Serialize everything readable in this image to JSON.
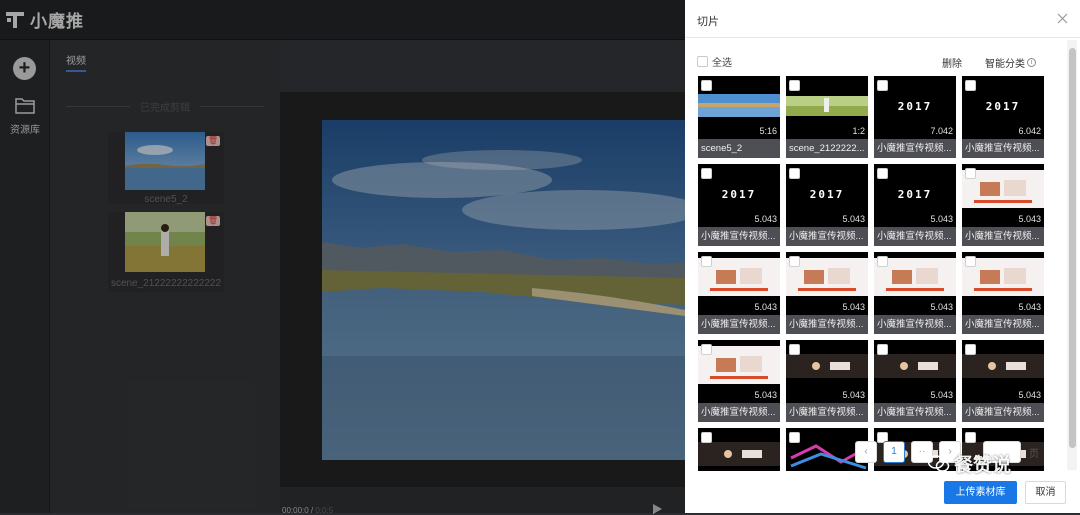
{
  "app": {
    "name": "小魔推"
  },
  "rail": {
    "library_label": "资源库"
  },
  "panel": {
    "tab_label": "视频",
    "section_label": "已完成剪辑",
    "clips": [
      {
        "name": "scene5_2"
      },
      {
        "name": "scene_21222222222222"
      }
    ]
  },
  "preview": {
    "time_current": "00:00:0 / ",
    "time_total": "0:0:5"
  },
  "drawer": {
    "title": "切片",
    "select_all": "全选",
    "delete": "删除",
    "smart_classify": "智能分类",
    "tiles": [
      {
        "caption": "scene5_2",
        "duration": "5:16",
        "thumb": "landscape"
      },
      {
        "caption": "scene_2122222...",
        "duration": "1:2",
        "thumb": "field"
      },
      {
        "caption": "小魔推宣传视频...",
        "duration": "7.042",
        "thumb": "logo"
      },
      {
        "caption": "小魔推宣传视频...",
        "duration": "6.042",
        "thumb": "logo"
      },
      {
        "caption": "小魔推宣传视频...",
        "duration": "5.043",
        "thumb": "logo"
      },
      {
        "caption": "小魔推宣传视频...",
        "duration": "5.043",
        "thumb": "logo"
      },
      {
        "caption": "小魔推宣传视频...",
        "duration": "5.043",
        "thumb": "logo"
      },
      {
        "caption": "小魔推宣传视频...",
        "duration": "5.043",
        "thumb": "web"
      },
      {
        "caption": "小魔推宣传视频...",
        "duration": "5.043",
        "thumb": "web"
      },
      {
        "caption": "小魔推宣传视频...",
        "duration": "5.043",
        "thumb": "web"
      },
      {
        "caption": "小魔推宣传视频...",
        "duration": "5.043",
        "thumb": "web"
      },
      {
        "caption": "小魔推宣传视频...",
        "duration": "5.043",
        "thumb": "web"
      },
      {
        "caption": "小魔推宣传视频...",
        "duration": "5.043",
        "thumb": "web"
      },
      {
        "caption": "小魔推宣传视频...",
        "duration": "5.043",
        "thumb": "dark"
      },
      {
        "caption": "小魔推宣传视频...",
        "duration": "5.043",
        "thumb": "dark"
      },
      {
        "caption": "小魔推宣传视频...",
        "duration": "5.043",
        "thumb": "dark"
      },
      {
        "caption": "",
        "duration": "",
        "thumb": "dark"
      },
      {
        "caption": "",
        "duration": "",
        "thumb": "colorful"
      },
      {
        "caption": "",
        "duration": "",
        "thumb": "dark"
      },
      {
        "caption": "",
        "duration": "",
        "thumb": "dark"
      }
    ],
    "pagination": {
      "current_page": "1",
      "suffix": "页"
    },
    "upload_button": "上传素材库",
    "cancel_button": "取消",
    "watermark_text": "餐赞说"
  },
  "colors": {
    "primary": "#1a78e6",
    "page_active": "#2b7cd3"
  },
  "icons": [
    "logo-icon",
    "add-icon",
    "folder-icon",
    "close-icon",
    "info-icon",
    "play-icon",
    "wechat-icon"
  ]
}
